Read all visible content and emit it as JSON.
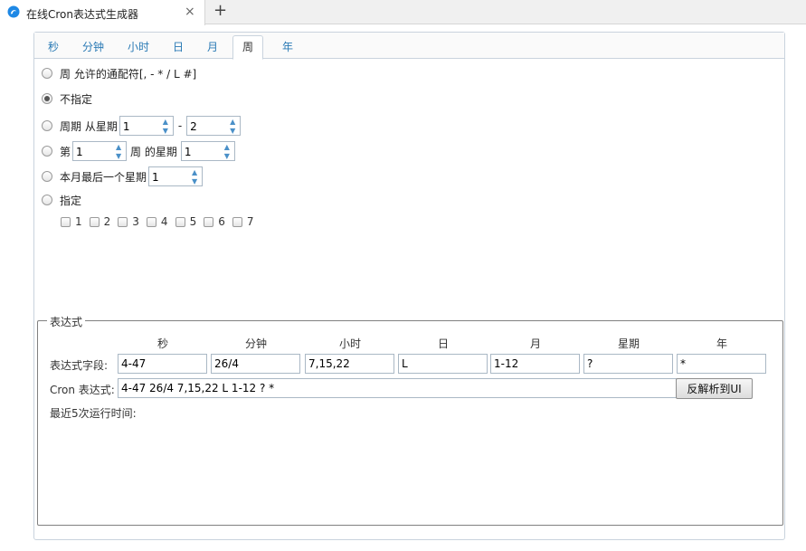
{
  "browser": {
    "tab_title": "在线Cron表达式生成器",
    "close_symbol": "×",
    "new_tab_symbol": "+"
  },
  "tabs": [
    "秒",
    "分钟",
    "小时",
    "日",
    "月",
    "周",
    "年"
  ],
  "active_tab": "周",
  "week": {
    "opt_allowed": "周 允许的通配符[, - * / L #]",
    "opt_unspecified": "不指定",
    "opt_cycle_prefix": "周期 从星期",
    "cycle_from": "1",
    "cycle_dash": "-",
    "cycle_to": "2",
    "opt_nth_prefix": "第",
    "nth_week": "1",
    "nth_mid": "周 的星期",
    "nth_day": "1",
    "opt_last_prefix": "本月最后一个星期",
    "last_day": "1",
    "opt_specify": "指定",
    "checkboxes": [
      "1",
      "2",
      "3",
      "4",
      "5",
      "6",
      "7"
    ],
    "selected_option": "opt_unspecified"
  },
  "expression": {
    "legend": "表达式",
    "columns": [
      "秒",
      "分钟",
      "小时",
      "日",
      "月",
      "星期",
      "年"
    ],
    "fields_label": "表达式字段:",
    "values": [
      "4-47",
      "26/4",
      "7,15,22",
      "L",
      "1-12",
      "?",
      "*"
    ],
    "cron_label": "Cron 表达式:",
    "cron_value": "4-47 26/4 7,15,22 L 1-12 ? *",
    "parse_button": "反解析到UI",
    "recent_label": "最近5次运行时间:"
  }
}
